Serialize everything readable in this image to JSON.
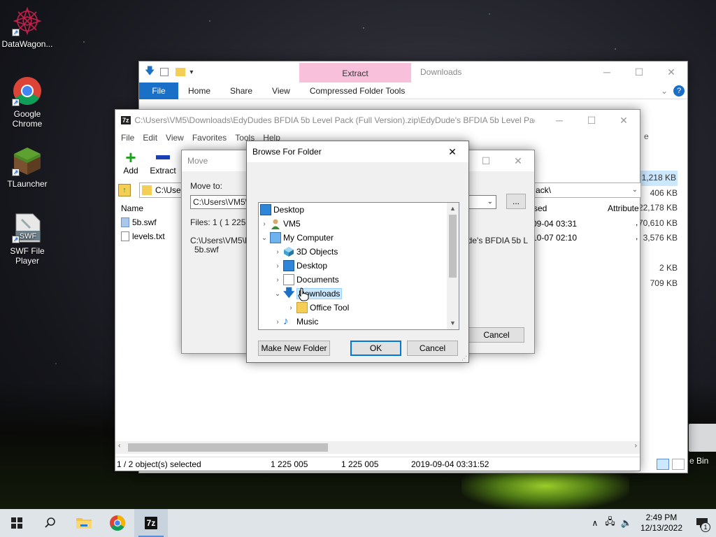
{
  "desktop": {
    "icons": [
      {
        "label": "DataWagon...",
        "icon": "datawagon-icon"
      },
      {
        "label": "Google Chrome",
        "icon": "chrome-icon"
      },
      {
        "label": "TLauncher",
        "icon": "minecraft-block-icon"
      },
      {
        "label": "SWF File Player",
        "icon": "swf-file-icon"
      }
    ],
    "recycle_bin_partial": "e Bin"
  },
  "explorer": {
    "title": "Downloads",
    "context_tab": "Extract",
    "tabs": [
      "File",
      "Home",
      "Share",
      "View",
      "Compressed Folder Tools"
    ],
    "partial_header": "e",
    "sizes": [
      "1,218 KB",
      "406 KB",
      "22,178 KB",
      "70,610 KB",
      "3,576 KB",
      "",
      "2 KB",
      "709 KB"
    ]
  },
  "sevenzip": {
    "title": "C:\\Users\\VM5\\Downloads\\EdyDudes BFDIA 5b Level Pack (Full Version).zip\\EdyDude's BFDIA 5b Level Pack\\",
    "app_icon_text": "7z",
    "menu": [
      "File",
      "Edit",
      "View",
      "Favorites",
      "Tools",
      "Help"
    ],
    "toolbar": {
      "add": "Add",
      "extract": "Extract"
    },
    "address": "C:\\Users",
    "address_tail": "ack\\",
    "columns": {
      "name": "Name",
      "modified_partial": "sed",
      "attributes": "Attribute"
    },
    "files": [
      {
        "name": "5b.swf",
        "date_partial": "09-04 03:31",
        "attr": ","
      },
      {
        "name": "levels.txt",
        "date_partial": "10-07 02:10",
        "attr": ","
      }
    ],
    "status": {
      "selection": "1 / 2 object(s) selected",
      "size": "1 225 005",
      "packed": "1 225 005",
      "modified": "2019-09-04 03:31:52"
    }
  },
  "move_dialog": {
    "title": "Move",
    "move_to_label": "Move to:",
    "move_to_value": "C:\\Users\\VM5\\D",
    "files_label": "Files: 1    ( 1 225",
    "path_line1": "C:\\Users\\VM5\\D",
    "path_line2": "5b.swf",
    "path_right": "ude's BFDIA 5b L",
    "browse_button": "...",
    "cancel": "Cancel"
  },
  "browse_dialog": {
    "title": "Browse For Folder",
    "tree": [
      {
        "label": "Desktop",
        "level": 0,
        "expander": "",
        "icon": "desktop-icon"
      },
      {
        "label": "VM5",
        "level": 1,
        "expander": "›",
        "icon": "user-icon"
      },
      {
        "label": "My Computer",
        "level": 1,
        "expander": "⌄",
        "icon": "computer-icon"
      },
      {
        "label": "3D Objects",
        "level": 2,
        "expander": "›",
        "icon": "3d-objects-icon"
      },
      {
        "label": "Desktop",
        "level": 2,
        "expander": "›",
        "icon": "desktop-icon"
      },
      {
        "label": "Documents",
        "level": 2,
        "expander": "›",
        "icon": "documents-icon"
      },
      {
        "label": "Downloads",
        "level": 2,
        "expander": "⌄",
        "icon": "downloads-icon",
        "selected": true
      },
      {
        "label": "Office Tool",
        "level": 3,
        "expander": "›",
        "icon": "folder-icon"
      },
      {
        "label": "Music",
        "level": 2,
        "expander": "›",
        "icon": "music-icon"
      }
    ],
    "buttons": {
      "new_folder": "Make New Folder",
      "ok": "OK",
      "cancel": "Cancel"
    }
  },
  "taskbar": {
    "time": "2:49 PM",
    "date": "12/13/2022",
    "notification_count": "1",
    "accent": "#0078d7"
  }
}
